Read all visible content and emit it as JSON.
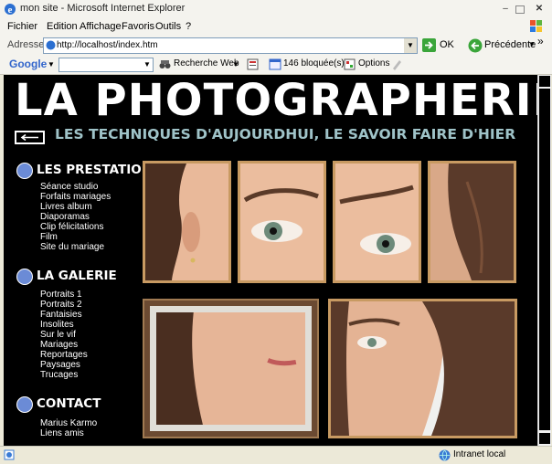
{
  "window": {
    "title": "mon site - Microsoft Internet Explorer"
  },
  "menu": {
    "items": [
      "Fichier",
      "Edition",
      "Affichage",
      "Favoris",
      "Outils",
      "?"
    ]
  },
  "address": {
    "label": "Adresse",
    "url": "http://localhost/index.htm",
    "go_label": "OK",
    "back_label": "Précédente",
    "chevron": "»"
  },
  "google": {
    "logo": "Google",
    "search_web": "Recherche Web",
    "blocked": "146 bloquée(s)",
    "options": "Options"
  },
  "page": {
    "title": "LA PHOTOGRAPHERIE",
    "tagline": "LES TECHNIQUES D'AUJOURDHUI, LE SAVOIR FAIRE D'HIER",
    "sections": [
      {
        "title": "LES PRESTATIONS",
        "items": [
          "Séance studio",
          "Forfaits mariages",
          "Livres album",
          "Diaporamas",
          "Clip félicitations",
          "Film",
          "Site du mariage"
        ]
      },
      {
        "title": "LA GALERIE",
        "items": [
          "Portraits 1",
          "Portraits 2",
          "Fantaisies",
          "Insolites",
          "Sur le vif",
          "Mariages",
          "Reportages",
          "Paysages",
          "Trucages"
        ]
      },
      {
        "title": "CONTACT",
        "items": [
          "Marius Karmo",
          "Liens amis"
        ]
      }
    ]
  },
  "status": {
    "zone": "Intranet local"
  },
  "colors": {
    "tagline": "#9fc3c8",
    "frame": "#c89a62",
    "page_bg": "#000000"
  }
}
